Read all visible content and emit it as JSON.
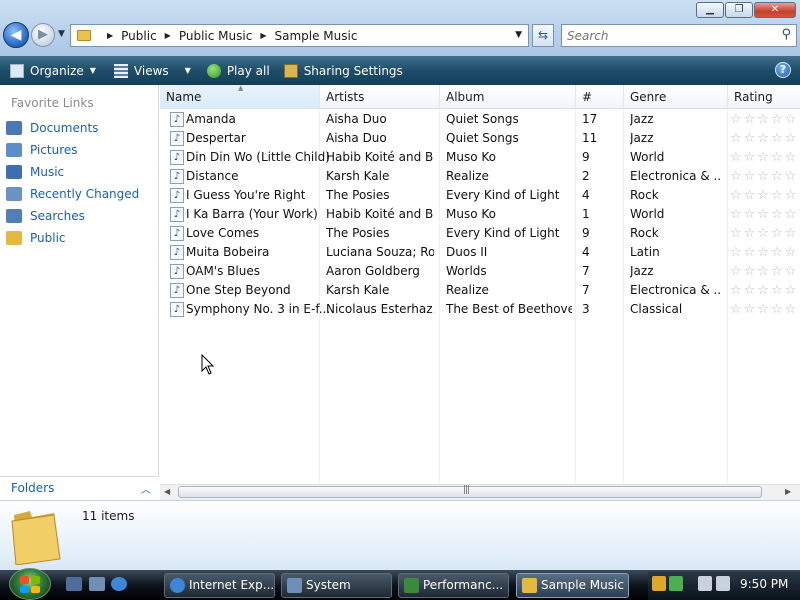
{
  "window": {
    "buttons": [
      "▁",
      "❐",
      "✕"
    ],
    "address": {
      "crumbs": [
        "Public",
        "Public Music",
        "Sample Music"
      ]
    },
    "search": {
      "placeholder": "Search"
    }
  },
  "toolbar": {
    "items": [
      {
        "label": "Organize",
        "icon": "organize-icon",
        "dropdown": true
      },
      {
        "label": "Views",
        "icon": "views-icon",
        "dropdown": true
      },
      {
        "label": "Play all",
        "icon": "play-icon",
        "dropdown": false
      },
      {
        "label": "Sharing Settings",
        "icon": "sharing-icon",
        "dropdown": false
      }
    ],
    "help_label": "?"
  },
  "sidebar": {
    "title": "Favorite Links",
    "items": [
      {
        "label": "Documents",
        "icon": "documents-icon",
        "color": "#4a78b5"
      },
      {
        "label": "Pictures",
        "icon": "pictures-icon",
        "color": "#5c8fc9"
      },
      {
        "label": "Music",
        "icon": "music-icon",
        "color": "#3b6fb0"
      },
      {
        "label": "Recently Changed",
        "icon": "recent-icon",
        "color": "#6a93c2"
      },
      {
        "label": "Searches",
        "icon": "searches-icon",
        "color": "#4f7fb8"
      },
      {
        "label": "Public",
        "icon": "public-folder-icon",
        "color": "#e3b93e"
      }
    ],
    "folders_label": "Folders"
  },
  "list": {
    "columns": [
      "Name",
      "Artists",
      "Album",
      "#",
      "Genre",
      "Rating"
    ],
    "rows": [
      {
        "name": "Amanda",
        "artist": "Aisha Duo",
        "album": "Quiet Songs",
        "num": "17",
        "genre": "Jazz"
      },
      {
        "name": "Despertar",
        "artist": "Aisha Duo",
        "album": "Quiet Songs",
        "num": "11",
        "genre": "Jazz"
      },
      {
        "name": "Din Din Wo (Little Child)",
        "artist": "Habib Koité and B...",
        "album": "Muso Ko",
        "num": "9",
        "genre": "World"
      },
      {
        "name": "Distance",
        "artist": "Karsh Kale",
        "album": "Realize",
        "num": "2",
        "genre": "Electronica & ..."
      },
      {
        "name": "I Guess You're Right",
        "artist": "The Posies",
        "album": "Every Kind of Light",
        "num": "4",
        "genre": "Rock"
      },
      {
        "name": "I Ka Barra (Your Work)",
        "artist": "Habib Koité and B...",
        "album": "Muso Ko",
        "num": "1",
        "genre": "World"
      },
      {
        "name": "Love Comes",
        "artist": "The Posies",
        "album": "Every Kind of Light",
        "num": "9",
        "genre": "Rock"
      },
      {
        "name": "Muita Bobeira",
        "artist": "Luciana Souza; Ro...",
        "album": "Duos II",
        "num": "4",
        "genre": "Latin"
      },
      {
        "name": "OAM's Blues",
        "artist": "Aaron Goldberg",
        "album": "Worlds",
        "num": "7",
        "genre": "Jazz"
      },
      {
        "name": "One Step Beyond",
        "artist": "Karsh Kale",
        "album": "Realize",
        "num": "7",
        "genre": "Electronica & ..."
      },
      {
        "name": "Symphony No. 3 in E-f...",
        "artist": "Nicolaus Esterhaz...",
        "album": "The Best of Beethoven",
        "num": "3",
        "genre": "Classical"
      }
    ],
    "rating_stars": "☆☆☆☆☆",
    "rating_value": 0
  },
  "details": {
    "count_text": "11 items"
  },
  "taskbar": {
    "tasks": [
      {
        "label": "Internet Exp...",
        "icon": "ie-icon",
        "color": "#3e86d8",
        "active": false
      },
      {
        "label": "System",
        "icon": "system-icon",
        "color": "#6d8fb8",
        "active": false
      },
      {
        "label": "Performanc...",
        "icon": "performance-icon",
        "color": "#3a8a3a",
        "active": false
      },
      {
        "label": "Sample Music",
        "icon": "folder-icon",
        "color": "#e3b93e",
        "active": true
      }
    ],
    "clock": "9:50 PM"
  }
}
